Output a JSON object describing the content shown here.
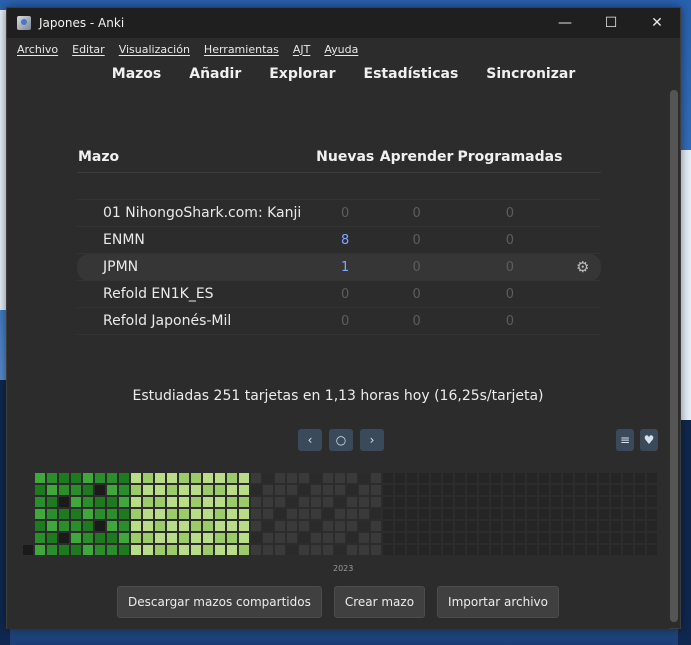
{
  "window": {
    "title": "Japones - Anki",
    "controls": {
      "minimize": "—",
      "maximize": "☐",
      "close": "✕"
    }
  },
  "menu": [
    "Archivo",
    "Editar",
    "Visualización",
    "Herramientas",
    "AJT",
    "Ayuda"
  ],
  "toolbar": [
    "Mazos",
    "Añadir",
    "Explorar",
    "Estadísticas",
    "Sincronizar"
  ],
  "deck_table": {
    "headers": {
      "deck": "Mazo",
      "new": "Nuevas",
      "learn": "Aprender",
      "due": "Programadas"
    },
    "rows": [
      {
        "name": "01 NihongoShark.com: Kanji",
        "new": "0",
        "learn": "0",
        "due": "0"
      },
      {
        "name": "ENMN",
        "new": "8",
        "learn": "0",
        "due": "0"
      },
      {
        "name": "JPMN",
        "new": "1",
        "learn": "0",
        "due": "0"
      },
      {
        "name": "Refold EN1K_ES",
        "new": "0",
        "learn": "0",
        "due": "0"
      },
      {
        "name": "Refold Japonés-Mil",
        "new": "0",
        "learn": "0",
        "due": "0"
      }
    ],
    "current_deck": "JPMN",
    "gear_icon": "gear-icon"
  },
  "studied_text": "Estudiadas 251 tarjetas en 1,13 horas hoy (16,25s/tarjeta)",
  "heatmap": {
    "nav": {
      "prev": "‹",
      "today": "○",
      "next": "›"
    },
    "options_icon": "sliders-icon",
    "favorite_icon": "heart-icon",
    "year_label": "2023",
    "colors": [
      "#3a3a3a",
      "#1e7a1e",
      "#2a8f2a",
      "#3ea83a",
      "#9ccb6a",
      "#b9dc88",
      "#1a1a1a"
    ]
  },
  "buttons": {
    "download": "Descargar mazos compartidos",
    "create": "Crear mazo",
    "import": "Importar archivo"
  }
}
